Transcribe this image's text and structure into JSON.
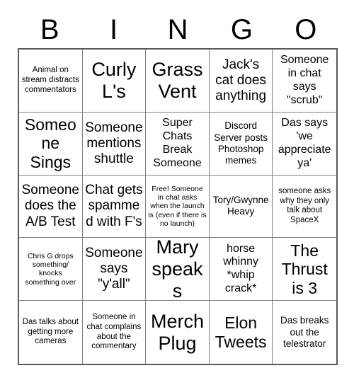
{
  "card": {
    "title": "BINGO",
    "header_letters": [
      "B",
      "I",
      "N",
      "G",
      "O"
    ],
    "grid_size": "5x5",
    "colors": {
      "background": "#ffffff",
      "text": "#000000",
      "grid_border": "#595959",
      "cell_border": "#808080"
    },
    "rows": [
      {
        "cells": [
          {
            "text": "Animal on stream distracts commentators",
            "size": "xs",
            "free": false
          },
          {
            "text": "Curly L's",
            "size": "xxl",
            "free": false
          },
          {
            "text": "Grass Vent",
            "size": "xxl",
            "free": false
          },
          {
            "text": "Jack's cat does anything",
            "size": "lg",
            "free": false
          },
          {
            "text": "Someone in chat says \"scrub\"",
            "size": "md",
            "free": false
          }
        ]
      },
      {
        "cells": [
          {
            "text": "Someone Sings",
            "size": "xl",
            "free": false
          },
          {
            "text": "Someone mentions shuttle",
            "size": "lg",
            "free": false
          },
          {
            "text": "Super Chats Break Someone",
            "size": "md",
            "free": false
          },
          {
            "text": "Discord Server posts Photoshop memes",
            "size": "sm",
            "free": false
          },
          {
            "text": "Das says 'we appreciate ya'",
            "size": "md",
            "free": false
          }
        ]
      },
      {
        "cells": [
          {
            "text": "Someone does the A/B Test",
            "size": "lg",
            "free": false
          },
          {
            "text": "Chat gets spammed with F's",
            "size": "lg",
            "free": false
          },
          {
            "text": "Free! Someone in chat asks when the launch is (even if there is no launch)",
            "size": "xxs",
            "free": true
          },
          {
            "text": "Tory/Gwynne Heavy",
            "size": "sm",
            "free": false
          },
          {
            "text": "someone asks why they only talk about SpaceX",
            "size": "xs",
            "free": false
          }
        ]
      },
      {
        "cells": [
          {
            "text": "Chris G drops something/ knocks something over",
            "size": "xxs",
            "free": false
          },
          {
            "text": "Someone says \"y'all\"",
            "size": "lg",
            "free": false
          },
          {
            "text": "Mary speaks",
            "size": "xxl",
            "free": false
          },
          {
            "text": "horse whinny *whip crack*",
            "size": "md",
            "free": false
          },
          {
            "text": "The Thrust is 3",
            "size": "xl",
            "free": false
          }
        ]
      },
      {
        "cells": [
          {
            "text": "Das talks about getting more cameras",
            "size": "xs",
            "free": false
          },
          {
            "text": "Someone in chat complains about the commentary",
            "size": "xs",
            "free": false
          },
          {
            "text": "Merch Plug",
            "size": "xxl",
            "free": false
          },
          {
            "text": "Elon Tweets",
            "size": "xl",
            "free": false
          },
          {
            "text": "Das breaks out the telestrator",
            "size": "sm",
            "free": false
          }
        ]
      }
    ]
  }
}
